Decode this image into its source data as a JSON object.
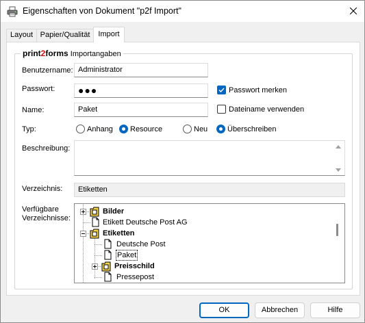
{
  "window": {
    "title": "Eigenschaften von Dokument \"p2f Import\""
  },
  "tabs": [
    {
      "label": "Layout"
    },
    {
      "label": "Papier/Qualität"
    },
    {
      "label": "Import"
    }
  ],
  "group": {
    "brand_a": "print",
    "brand_b": "2",
    "brand_c": "forms",
    "title": " Importangaben"
  },
  "form": {
    "username_label": "Benutzername:",
    "username_value": "Administrator",
    "password_label": "Passwort:",
    "password_value": "●●●",
    "remember_password_label": "Passwort merken",
    "remember_password_checked": true,
    "name_label": "Name:",
    "name_value": "Paket",
    "use_filename_label": "Dateiname verwenden",
    "use_filename_checked": false,
    "type_label": "Typ:",
    "type_options": [
      {
        "label": "Anhang",
        "checked": false
      },
      {
        "label": "Resource",
        "checked": true
      }
    ],
    "mode_options": [
      {
        "label": "Neu",
        "checked": false
      },
      {
        "label": "Überschreiben",
        "checked": true
      }
    ],
    "description_label": "Beschreibung:",
    "description_value": "",
    "directory_label": "Verzeichnis:",
    "directory_value": "Etiketten",
    "available_dirs_label_1": "Verfügbare",
    "available_dirs_label_2": "Verzeichnisse:"
  },
  "tree": {
    "items": [
      {
        "label": "Bilder",
        "type": "folder",
        "bold": true,
        "expandable": true,
        "expanded": false
      },
      {
        "label": "Etikett Deutsche Post AG",
        "type": "file",
        "bold": false
      },
      {
        "label": "Etiketten",
        "type": "folder",
        "bold": true,
        "expandable": true,
        "expanded": true
      },
      {
        "label": "Deutsche Post",
        "type": "file",
        "bold": false
      },
      {
        "label": "Paket",
        "type": "file",
        "bold": false,
        "selected": true
      },
      {
        "label": "Preisschild",
        "type": "folder",
        "bold": true,
        "expandable": true,
        "expanded": false
      },
      {
        "label": "Pressepost",
        "type": "file",
        "bold": false
      }
    ]
  },
  "buttons": {
    "ok": "OK",
    "cancel": "Abbrechen",
    "help": "Hilfe"
  },
  "colors": {
    "accent": "#0067c0",
    "brand_red": "#c81414",
    "folder_yellow": "#f5d24b"
  },
  "icons": {
    "app": "printer-icon",
    "close": "close-icon",
    "folder": "folder-icon",
    "file": "document-icon"
  }
}
